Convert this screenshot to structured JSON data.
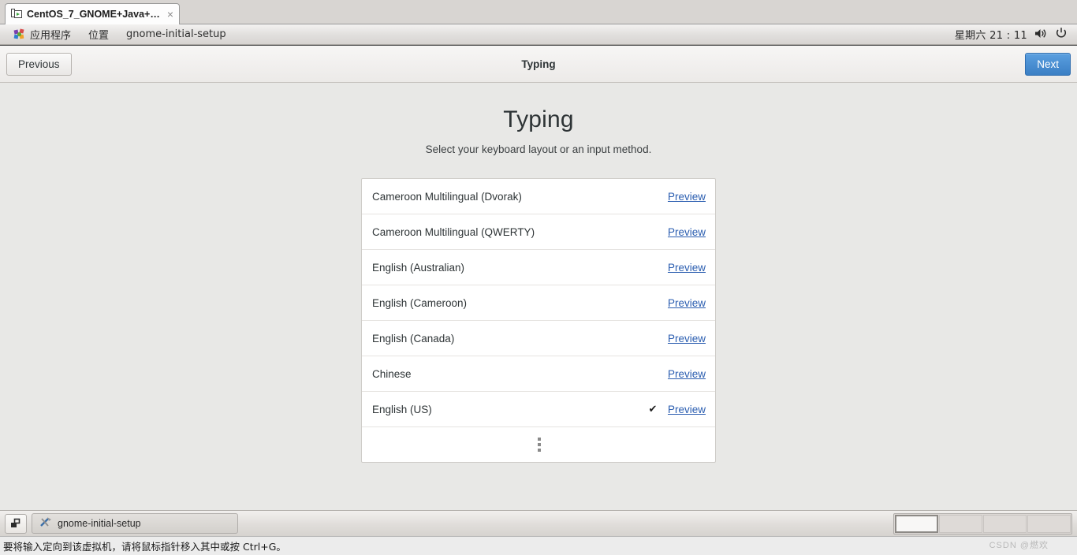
{
  "vm_tab": {
    "label": "CentOS_7_GNOME+Java+…",
    "icon": "vm-screen-icon",
    "close_icon": "×"
  },
  "gnome_panel": {
    "applications_label": "应用程序",
    "places_label": "位置",
    "app_name": "gnome-initial-setup",
    "clock": "星期六  21 : 11",
    "volume_icon": "speaker-icon",
    "power_icon": "power-icon",
    "apps_icon": "gnome-foot-icon"
  },
  "headerbar": {
    "previous_label": "Previous",
    "title": "Typing",
    "next_label": "Next",
    "next_color": "#3b7fc4"
  },
  "page": {
    "title": "Typing",
    "subtitle": "Select your keyboard layout or an input method.",
    "preview_label": "Preview",
    "check_glyph": "✔",
    "link_color": "#2a5db0",
    "items": [
      {
        "name": "Cameroon Multilingual (Dvorak)",
        "selected": false
      },
      {
        "name": "Cameroon Multilingual (QWERTY)",
        "selected": false
      },
      {
        "name": "English (Australian)",
        "selected": false
      },
      {
        "name": "English (Cameroon)",
        "selected": false
      },
      {
        "name": "English (Canada)",
        "selected": false
      },
      {
        "name": "Chinese",
        "selected": false
      },
      {
        "name": "English (US)",
        "selected": true
      }
    ],
    "more_icon": "vertical-ellipsis-icon"
  },
  "taskbar": {
    "show_desktop_icon": "show-desktop-icon",
    "window_label": "gnome-initial-setup",
    "window_icon": "tools-icon",
    "workspace_count": 4,
    "active_workspace": 1
  },
  "statusbar": {
    "message": "要将输入定向到该虚拟机，请将鼠标指针移入其中或按 Ctrl+G。"
  },
  "watermark": {
    "text": "CSDN @燃欢"
  }
}
